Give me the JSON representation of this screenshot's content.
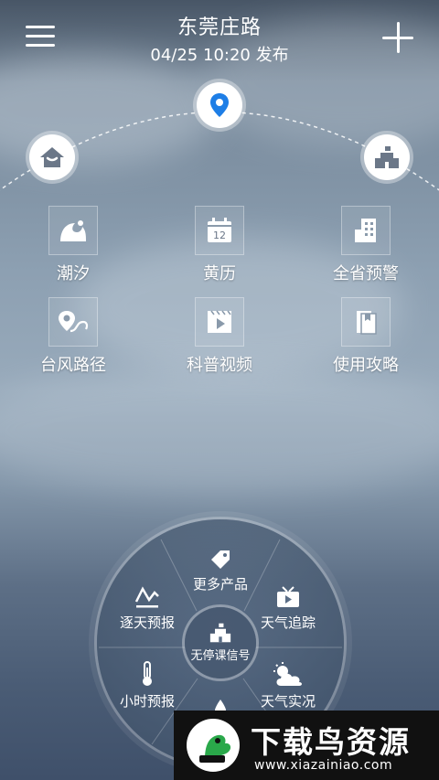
{
  "header": {
    "city": "东莞庄路",
    "publish_time": "04/25  10:20 发布"
  },
  "arc_nodes": [
    {
      "name": "location",
      "icon": "location-pin-icon",
      "color": "#1e7ee6"
    },
    {
      "name": "home",
      "icon": "house-icon",
      "color": "#6b7788"
    },
    {
      "name": "school",
      "icon": "school-icon",
      "color": "#6b7788"
    }
  ],
  "grid": [
    {
      "label": "潮汐",
      "icon": "wave-icon"
    },
    {
      "label": "黄历",
      "icon": "calendar-icon",
      "day": "12"
    },
    {
      "label": "全省预警",
      "icon": "buildings-icon"
    },
    {
      "label": "台风路径",
      "icon": "typhoon-path-icon"
    },
    {
      "label": "科普视频",
      "icon": "video-icon"
    },
    {
      "label": "使用攻略",
      "icon": "guide-book-icon"
    }
  ],
  "wheel": {
    "center": "无停课信号",
    "items": [
      {
        "label": "更多产品",
        "icon": "tag-icon"
      },
      {
        "label": "逐天预报",
        "icon": "trend-icon"
      },
      {
        "label": "天气追踪",
        "icon": "tv-icon"
      },
      {
        "label": "小时预报",
        "icon": "thermometer-icon"
      },
      {
        "label": "天气实况",
        "icon": "sun-cloud-icon"
      }
    ]
  },
  "banner": {
    "title": "下载鸟资源",
    "url": "www.xiazainiao.com"
  }
}
